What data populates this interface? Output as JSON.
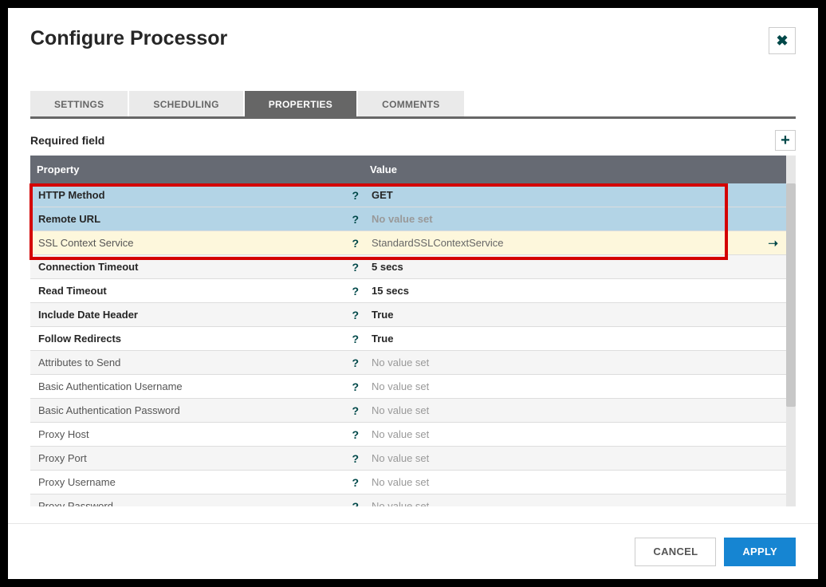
{
  "dialog": {
    "title": "Configure Processor"
  },
  "tabs": {
    "settings": "SETTINGS",
    "scheduling": "SCHEDULING",
    "properties": "PROPERTIES",
    "comments": "COMMENTS"
  },
  "panel": {
    "required_label": "Required field",
    "col_property": "Property",
    "col_value": "Value",
    "no_value": "No value set"
  },
  "properties": [
    {
      "name": "HTTP Method",
      "required": true,
      "value": "GET",
      "selected": "blue"
    },
    {
      "name": "Remote URL",
      "required": true,
      "value": null,
      "selected": "blue"
    },
    {
      "name": "SSL Context Service",
      "required": false,
      "value": "StandardSSLContextService",
      "selected": "cream",
      "goto": true
    },
    {
      "name": "Connection Timeout",
      "required": true,
      "value": "5 secs"
    },
    {
      "name": "Read Timeout",
      "required": true,
      "value": "15 secs"
    },
    {
      "name": "Include Date Header",
      "required": true,
      "value": "True"
    },
    {
      "name": "Follow Redirects",
      "required": true,
      "value": "True"
    },
    {
      "name": "Attributes to Send",
      "required": false,
      "value": null
    },
    {
      "name": "Basic Authentication Username",
      "required": false,
      "value": null
    },
    {
      "name": "Basic Authentication Password",
      "required": false,
      "value": null
    },
    {
      "name": "Proxy Host",
      "required": false,
      "value": null
    },
    {
      "name": "Proxy Port",
      "required": false,
      "value": null
    },
    {
      "name": "Proxy Username",
      "required": false,
      "value": null
    },
    {
      "name": "Proxy Password",
      "required": false,
      "value": null
    }
  ],
  "footer": {
    "cancel": "CANCEL",
    "apply": "APPLY"
  }
}
